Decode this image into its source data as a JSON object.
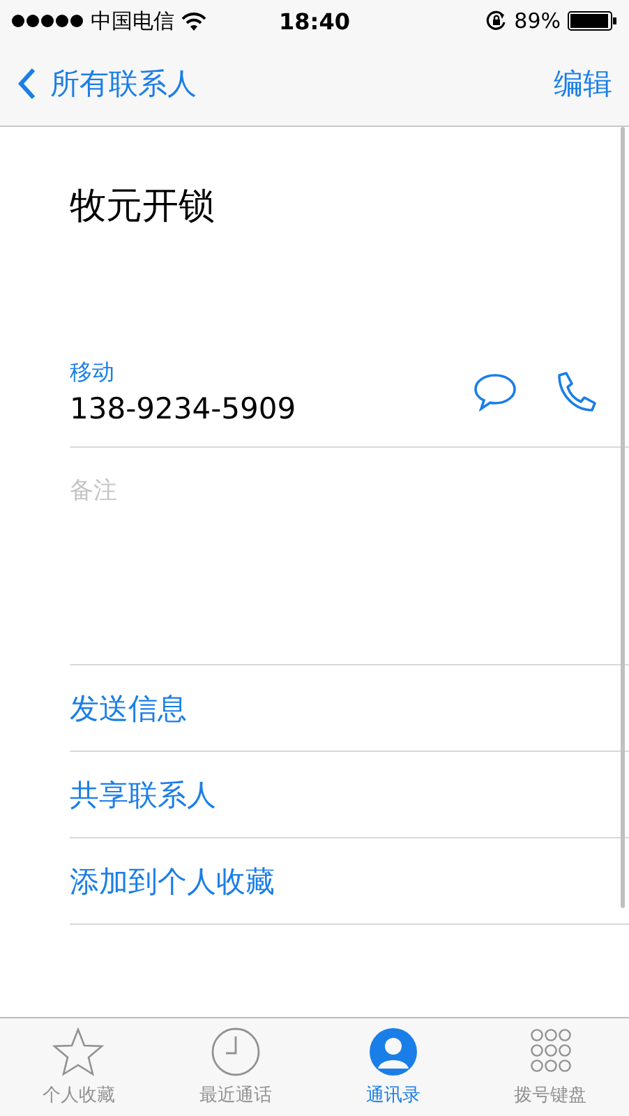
{
  "status_bar": {
    "carrier": "中国电信",
    "time": "18:40",
    "battery": "89%"
  },
  "nav": {
    "back": "所有联系人",
    "action": "编辑"
  },
  "contact": {
    "name": "牧元开锁",
    "phone_label": "移动",
    "phone": "138-9234-5909",
    "notes_placeholder": "备注"
  },
  "actions": [
    "发送信息",
    "共享联系人",
    "添加到个人收藏"
  ],
  "tabs": [
    {
      "label": "个人收藏",
      "selected": false
    },
    {
      "label": "最近通话",
      "selected": false
    },
    {
      "label": "通讯录",
      "selected": true
    },
    {
      "label": "拨号键盘",
      "selected": false
    }
  ]
}
